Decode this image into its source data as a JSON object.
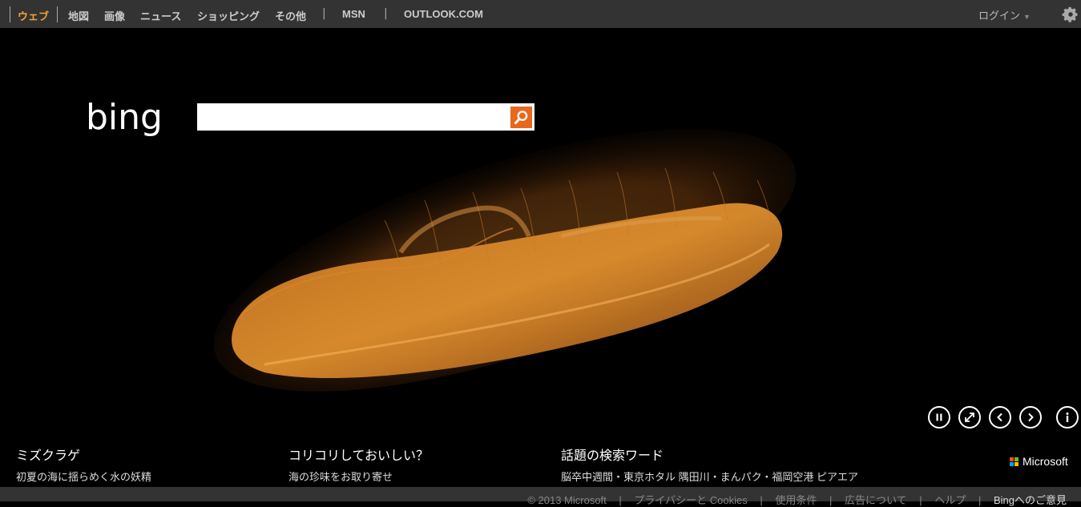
{
  "nav": {
    "items": [
      "ウェブ",
      "地図",
      "画像",
      "ニュース",
      "ショッピング",
      "その他",
      "MSN",
      "OUTLOOK.COM"
    ],
    "separator": "|",
    "login": "ログイン",
    "active_color": "#f2a23a"
  },
  "search": {
    "logo_text": "bing",
    "value": "",
    "button_color": "#e8681e"
  },
  "controls": [
    "pause-icon",
    "fullscreen-icon",
    "previous-icon",
    "next-icon",
    "info-icon"
  ],
  "captions": [
    {
      "title": "ミズクラゲ",
      "subtitle": "初夏の海に揺らめく水の妖精"
    },
    {
      "title": "コリコリしておいしい？",
      "subtitle": "海の珍味をお取り寄せ"
    },
    {
      "title": "話題の検索ワード",
      "subtitle": "脳卒中週間・東京ホタル 隅田川・まんパク・福岡空港 ピアエア"
    }
  ],
  "microsoft_logo": "Microsoft",
  "footer": {
    "copyright": "© 2013 Microsoft",
    "links": [
      "プライバシーと Cookies",
      "使用条件",
      "広告について",
      "ヘルプ",
      "Bingへのご意見"
    ],
    "separator": "|"
  }
}
